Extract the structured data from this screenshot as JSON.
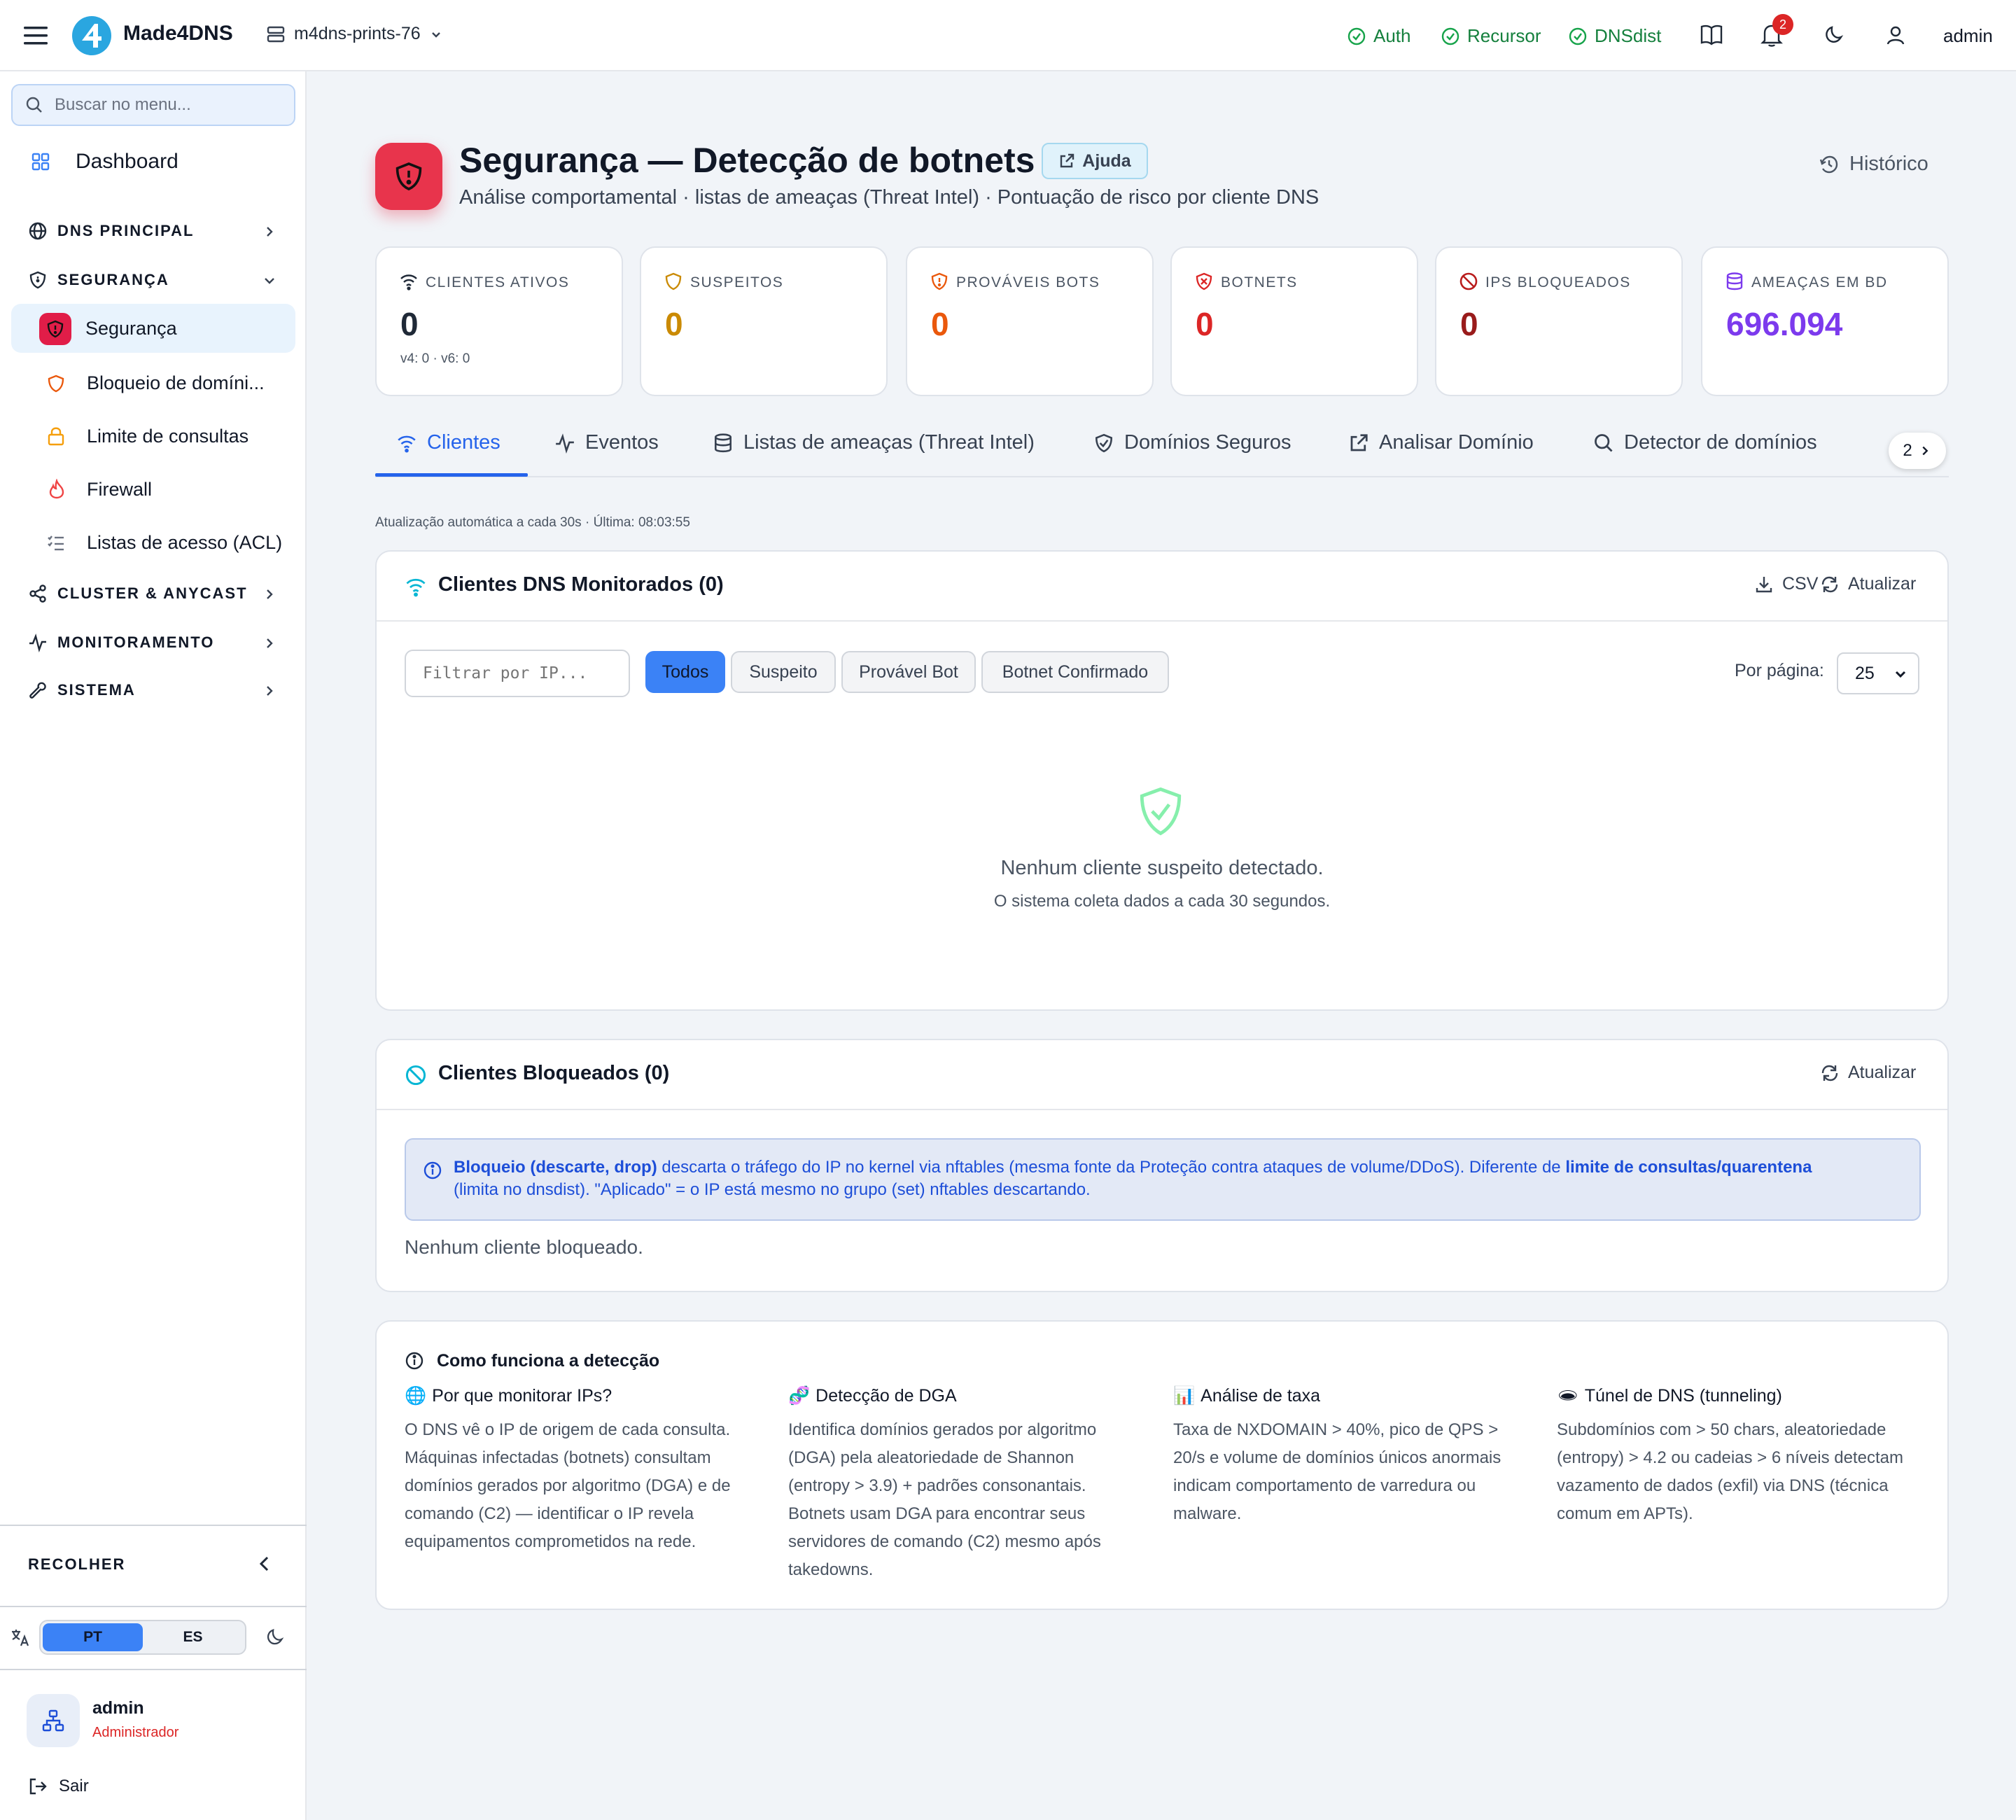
{
  "topbar": {
    "brand": "Made4DNS",
    "server": "m4dns-prints-76",
    "status": [
      "Auth",
      "Recursor",
      "DNSdist"
    ],
    "notif_count": "2",
    "user": "admin"
  },
  "sidebar": {
    "search_placeholder": "Buscar no menu...",
    "dashboard": "Dashboard",
    "sections": {
      "dns": "DNS PRINCIPAL",
      "seguranca": "SEGURANÇA",
      "cluster": "CLUSTER & ANYCAST",
      "monitor": "MONITORAMENTO",
      "sistema": "SISTEMA"
    },
    "items": [
      "Segurança",
      "Bloqueio de domíni...",
      "Limite de consultas",
      "Firewall",
      "Listas de acesso (ACL)"
    ],
    "collapse": "RECOLHER",
    "lang": [
      "PT",
      "ES"
    ],
    "user_name": "admin",
    "user_role": "Administrador",
    "logout": "Sair"
  },
  "page": {
    "title": "Segurança — Detecção de botnets",
    "help": "Ajuda",
    "subtitle": "Análise comportamental · listas de ameaças (Threat Intel) · Pontuação de risco por cliente DNS",
    "history": "Histórico"
  },
  "stats": [
    {
      "label": "CLIENTES ATIVOS",
      "value": "0",
      "sub": "v4: 0 · v6: 0",
      "color": "#1f2937"
    },
    {
      "label": "SUSPEITOS",
      "value": "0",
      "sub": "",
      "color": "#ca8a04"
    },
    {
      "label": "PROVÁVEIS BOTS",
      "value": "0",
      "sub": "",
      "color": "#ea580c"
    },
    {
      "label": "BOTNETS",
      "value": "0",
      "sub": "",
      "color": "#dc2626"
    },
    {
      "label": "IPS BLOQUEADOS",
      "value": "0",
      "sub": "",
      "color": "#991b1b"
    },
    {
      "label": "AMEAÇAS EM BD",
      "value": "696.094",
      "sub": "",
      "color": "#7c3aed"
    }
  ],
  "tabs": [
    "Clientes",
    "Eventos",
    "Listas de ameaças (Threat Intel)",
    "Domínios Seguros",
    "Analisar Domínio",
    "Detector de domínios"
  ],
  "tabs_more": "2",
  "autoupdate": "Atualização automática a cada 30s · Última: 08:03:55",
  "monitored": {
    "title": "Clientes DNS Monitorados (0)",
    "csv": "CSV",
    "refresh": "Atualizar",
    "filter_placeholder": "Filtrar por IP...",
    "filters": [
      "Todos",
      "Suspeito",
      "Provável Bot",
      "Botnet Confirmado"
    ],
    "per_page_label": "Por página:",
    "per_page": "25",
    "empty_title": "Nenhum cliente suspeito detectado.",
    "empty_sub": "O sistema coleta dados a cada 30 segundos."
  },
  "blocked": {
    "title": "Clientes Bloqueados (0)",
    "refresh": "Atualizar",
    "info_bold1": "Bloqueio (descarte, drop)",
    "info_text1": " descarta o tráfego do IP no kernel via nftables (mesma fonte da Proteção contra ataques de volume/DDoS). Diferente de ",
    "info_bold2": "limite de consultas/quarentena",
    "info_text2": "(limita no dnsdist). \"Aplicado\" = o IP está mesmo no grupo (set) nftables descartando.",
    "empty": "Nenhum cliente bloqueado."
  },
  "how": {
    "title": "Como funciona a detecção",
    "cols": [
      {
        "emoji": "🌐",
        "title": "Por que monitorar IPs?",
        "text": "O DNS vê o IP de origem de cada consulta. Máquinas infectadas (botnets) consultam domínios gerados por algoritmo (DGA) e de comando (C2) — identificar o IP revela equipamentos comprometidos na rede."
      },
      {
        "emoji": "🧬",
        "title": "Detecção de DGA",
        "text": "Identifica domínios gerados por algoritmo (DGA) pela aleatoriedade de Shannon (entropy > 3.9) + padrões consonantais. Botnets usam DGA para encontrar seus servidores de comando (C2) mesmo após takedowns."
      },
      {
        "emoji": "📊",
        "title": "Análise de taxa",
        "text": "Taxa de NXDOMAIN > 40%, pico de QPS > 20/s e volume de domínios únicos anormais indicam comportamento de varredura ou malware."
      },
      {
        "emoji": "🕳",
        "title": "Túnel de DNS (tunneling)",
        "text": "Subdomínios com > 50 chars, aleatoriedade (entropy) > 4.2 ou cadeias > 6 níveis detectam vazamento de dados (exfil) via DNS (técnica comum em APTs)."
      }
    ]
  }
}
